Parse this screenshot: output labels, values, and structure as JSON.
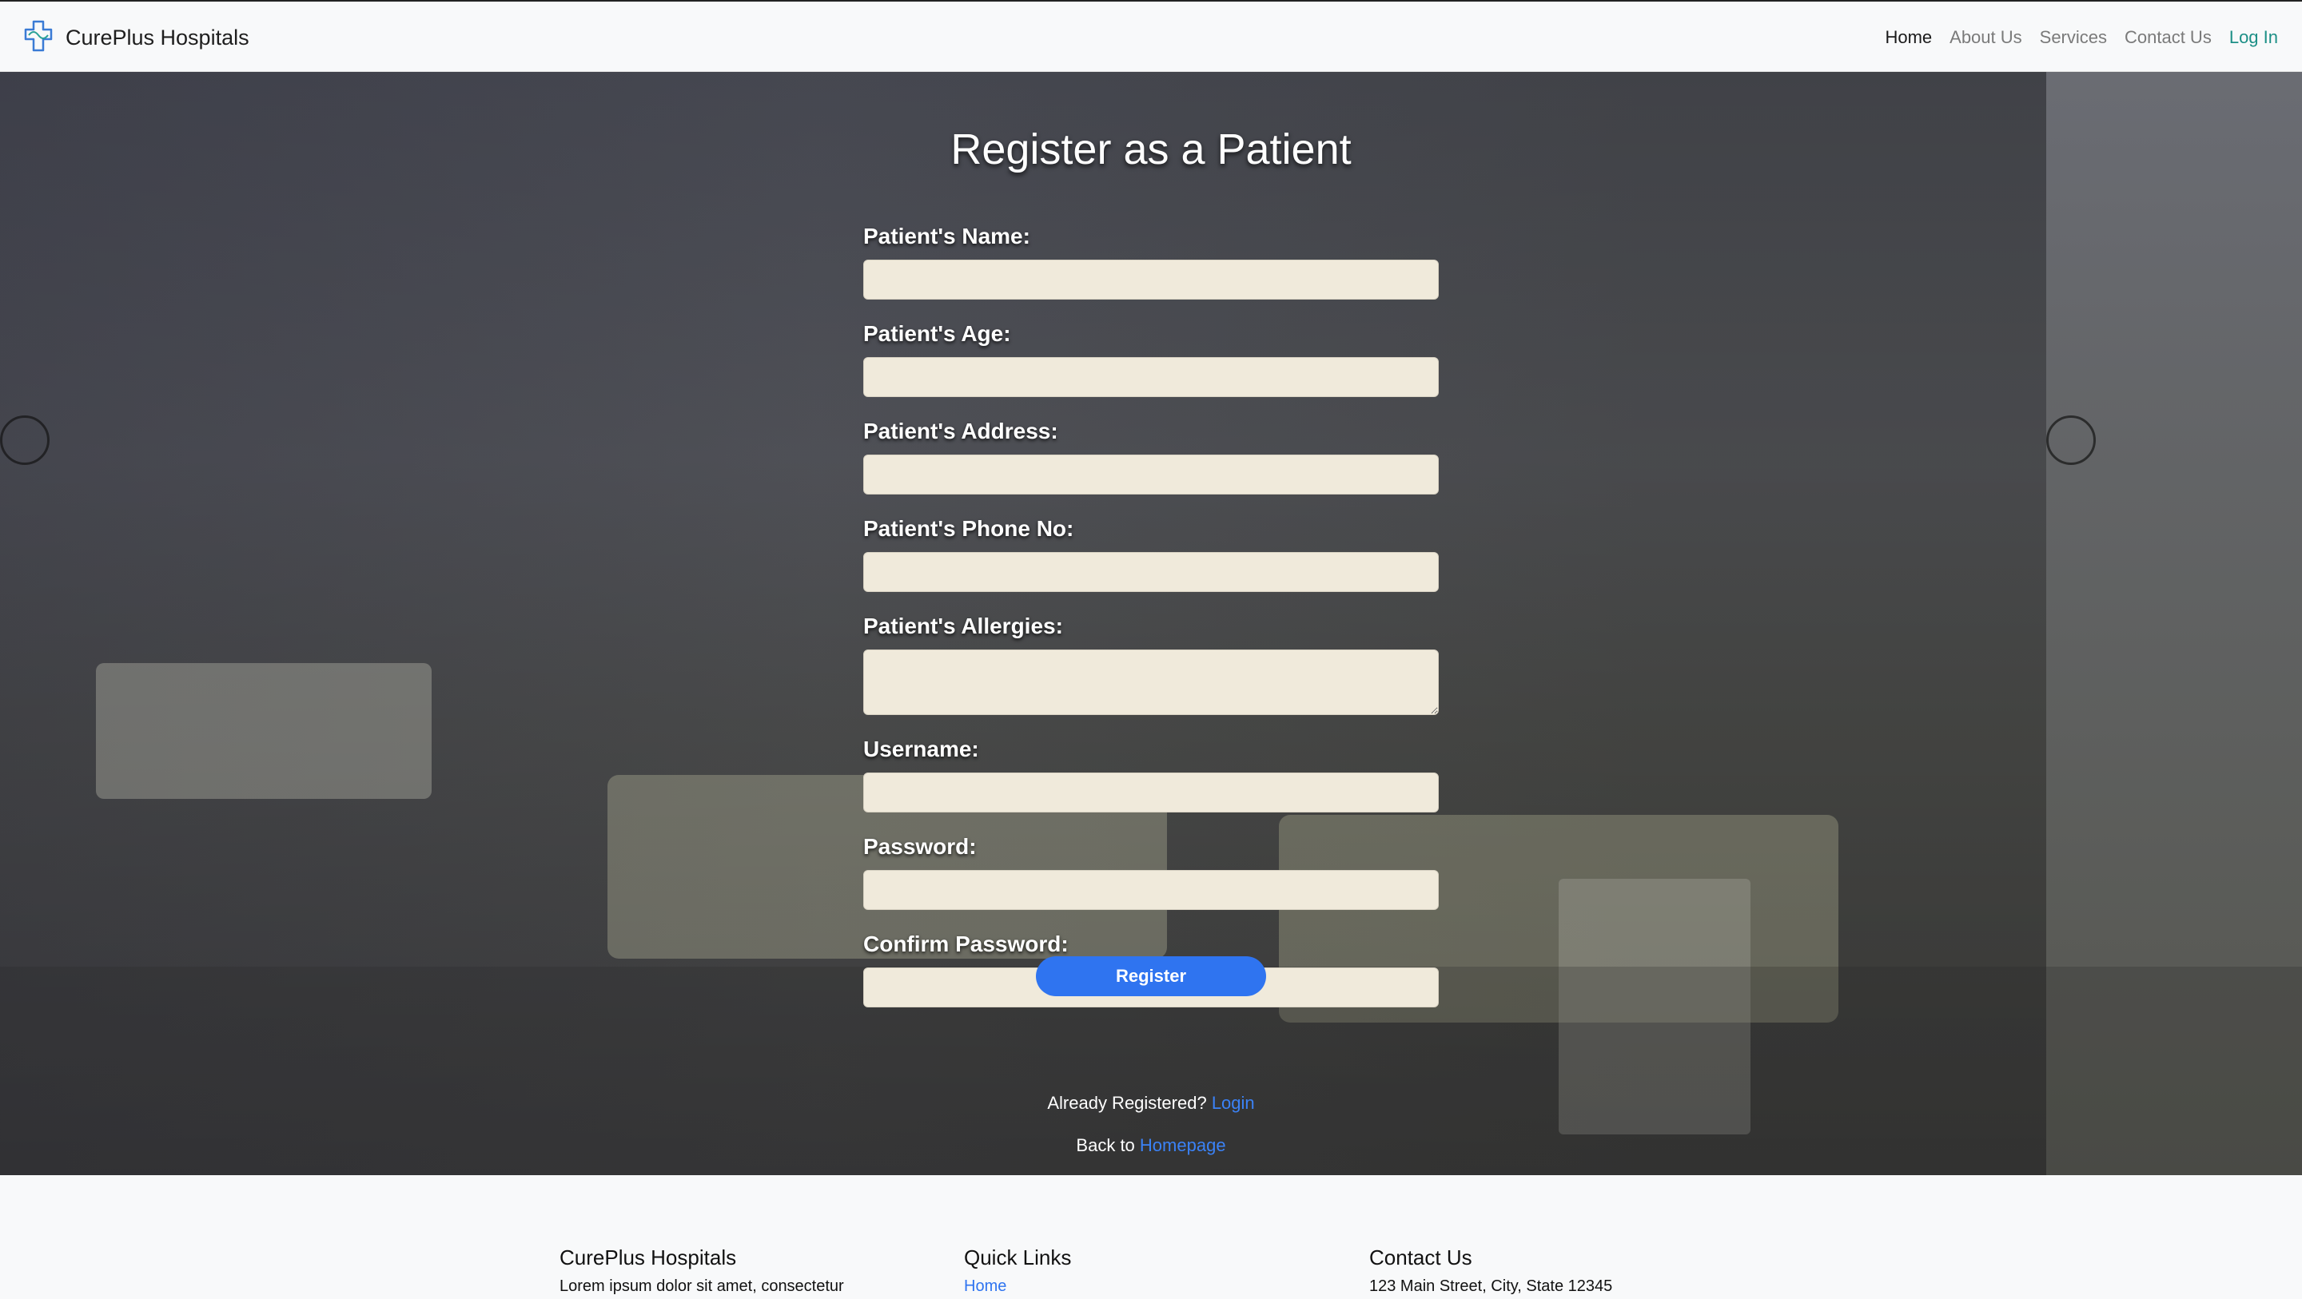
{
  "nav": {
    "brand": "CurePlus Hospitals",
    "links": [
      "Home",
      "About Us",
      "Services",
      "Contact Us",
      "Log In"
    ]
  },
  "form": {
    "title": "Register as a Patient",
    "labels": {
      "name": "Patient's Name:",
      "age": "Patient's Age:",
      "address": "Patient's Address:",
      "phone": "Patient's Phone No:",
      "allergies": "Patient's Allergies:",
      "username": "Username:",
      "password": "Password:",
      "confirm": "Confirm Password:"
    },
    "submit": "Register",
    "already_text": "Already Registered?",
    "login_link": "Login",
    "back_text": "Back to",
    "homepage_link": "Homepage"
  },
  "footer": {
    "col1_title": "CurePlus Hospitals",
    "col1_text": "Lorem ipsum dolor sit amet, consectetur",
    "col2_title": "Quick Links",
    "col2_link": "Home",
    "col3_title": "Contact Us",
    "col3_text": "123 Main Street, City, State 12345"
  },
  "colors": {
    "accent": "#2f74f0",
    "input_bg": "#f0eadb",
    "login_nav": "#1c8f86"
  }
}
